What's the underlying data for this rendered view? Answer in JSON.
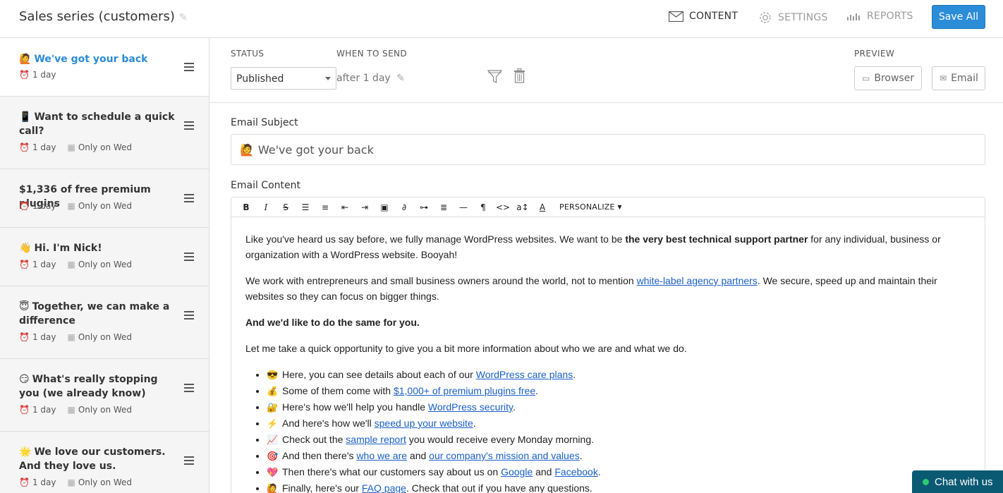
{
  "header": {
    "title": "Sales series (customers)",
    "tabs": [
      {
        "label": "CONTENT",
        "icon": "envelope-icon"
      },
      {
        "label": "SETTINGS",
        "icon": "gear-icon"
      },
      {
        "label": "REPORTS",
        "icon": "bar-chart-icon"
      }
    ],
    "save_label": "Save All"
  },
  "sidebar": {
    "items": [
      {
        "emoji": "🙋",
        "title": "We've got your back",
        "delay": "1 day",
        "day": ""
      },
      {
        "emoji": "📱",
        "title": "Want to schedule a quick call?",
        "delay": "1 day",
        "day": "Only on Wed"
      },
      {
        "emoji": "",
        "title": "$1,336 of free premium plugins",
        "delay": "1 day",
        "day": "Only on Wed"
      },
      {
        "emoji": "👋",
        "title": "Hi. I'm Nick!",
        "delay": "1 day",
        "day": "Only on Wed"
      },
      {
        "emoji": "😇",
        "title": "Together, we can make a difference",
        "delay": "1 day",
        "day": "Only on Wed"
      },
      {
        "emoji": "😏",
        "title": "What's really stopping you (we already know)",
        "delay": "1 day",
        "day": "Only on Wed"
      },
      {
        "emoji": "🌟",
        "title": "We love our customers. And they love us.",
        "delay": "1 day",
        "day": "Only on Wed"
      }
    ]
  },
  "settings": {
    "status_label": "STATUS",
    "status_value": "Published",
    "when_label": "WHEN TO SEND",
    "when_value": "after 1 day",
    "preview_label": "PREVIEW",
    "preview_browser": "Browser",
    "preview_email": "Email"
  },
  "subject": {
    "label": "Email Subject",
    "emoji": "🙋",
    "value": "We've got your back"
  },
  "content": {
    "label": "Email Content",
    "personalize_label": "PERSONALIZE",
    "p1_a": "Like you've heard us say before, we fully manage WordPress websites. We want to be ",
    "p1_bold": "the very best technical support partner",
    "p1_b": " for any individual, business or organization with a WordPress website. Booyah!",
    "p2_a": "We work with entrepreneurs and small business owners around the world, not to mention ",
    "p2_link": "white-label agency partners",
    "p2_b": ". We secure, speed up and maintain their websites so they can focus on bigger things.",
    "p3": "And we'd like to do the same for you.",
    "p4": "Let me take a quick opportunity to give you a bit more information about who we are and what we do.",
    "bullets": [
      {
        "emoji": "😎",
        "pre": "Here, you can see details about each of our ",
        "link1": "WordPress care plans",
        "mid": "",
        "link2": "",
        "post": "."
      },
      {
        "emoji": "💰",
        "pre": "Some of them come with ",
        "link1": "$1,000+ of premium plugins free",
        "mid": "",
        "link2": "",
        "post": "."
      },
      {
        "emoji": "🔐",
        "pre": "Here's how we'll help you handle ",
        "link1": "WordPress security",
        "mid": "",
        "link2": "",
        "post": "."
      },
      {
        "emoji": "⚡",
        "pre": "And here's how we'll ",
        "link1": "speed up your website",
        "mid": "",
        "link2": "",
        "post": "."
      },
      {
        "emoji": "📈",
        "pre": "Check out the ",
        "link1": "sample report",
        "mid": " you would receive every Monday morning.",
        "link2": "",
        "post": ""
      },
      {
        "emoji": "🎯",
        "pre": "And then there's ",
        "link1": "who we are",
        "mid": " and ",
        "link2": "our company's mission and values",
        "post": "."
      },
      {
        "emoji": "💖",
        "pre": "Then there's what our customers say about us on ",
        "link1": "Google",
        "mid": " and ",
        "link2": "Facebook",
        "post": "."
      },
      {
        "emoji": "🙋",
        "pre": "Finally, here's our ",
        "link1": "FAQ page",
        "mid": ". Check that out if you have any questions.",
        "link2": "",
        "post": ""
      }
    ]
  },
  "chat": {
    "label": "Chat with us"
  },
  "colors": {
    "accent": "#2b8cd8",
    "link": "#1a5fc8",
    "chat_bg": "#0b5a73"
  }
}
